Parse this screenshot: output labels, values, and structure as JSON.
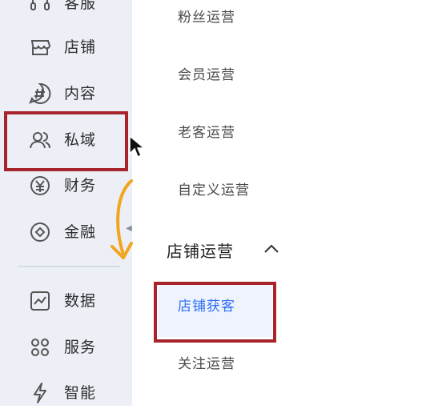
{
  "sidebar": {
    "items": [
      {
        "label": "客服",
        "icon": "headset-icon"
      },
      {
        "label": "店铺",
        "icon": "store-icon"
      },
      {
        "label": "内容",
        "icon": "hashtag-icon"
      },
      {
        "label": "私域",
        "icon": "users-icon"
      },
      {
        "label": "财务",
        "icon": "yen-icon"
      },
      {
        "label": "金融",
        "icon": "coin-icon"
      },
      {
        "label": "数据",
        "icon": "chart-icon"
      },
      {
        "label": "服务",
        "icon": "grid-icon"
      },
      {
        "label": "智能",
        "icon": "bolt-icon"
      }
    ]
  },
  "submenu": {
    "items_top": [
      "粉丝运营",
      "会员运营",
      "老客运营",
      "自定义运营"
    ],
    "section_title": "店铺运营",
    "active_item": "店铺获客",
    "items_bottom": [
      "关注运营"
    ]
  },
  "colors": {
    "sidebar_bg": "#eceff6",
    "active_text": "#2f6ff5",
    "highlight": "#a8232b",
    "arrow": "#f2a51e"
  }
}
